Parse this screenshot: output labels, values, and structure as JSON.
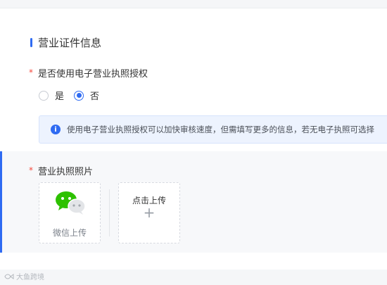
{
  "section": {
    "title": "营业证件信息"
  },
  "license_auth": {
    "required_mark": "*",
    "label": "是否使用电子营业执照授权",
    "options": [
      {
        "label": "是",
        "checked": false
      },
      {
        "label": "否",
        "checked": true
      }
    ],
    "info_icon_glyph": "i",
    "info_text": "使用电子营业执照授权可以加快审核速度，但需填写更多的信息，若无电子执照可选择"
  },
  "license_photo": {
    "required_mark": "*",
    "label": "营业执照照片",
    "wechat_upload_label": "微信上传",
    "click_upload_label": "点击上传",
    "plus_glyph": "+"
  },
  "watermark": {
    "text": "大鱼跨境"
  },
  "colors": {
    "accent": "#2f6bf2",
    "required": "#f5483b",
    "wechat_green": "#2dc100"
  },
  "icons": [
    "info-icon",
    "wechat-icon",
    "plus-icon"
  ]
}
